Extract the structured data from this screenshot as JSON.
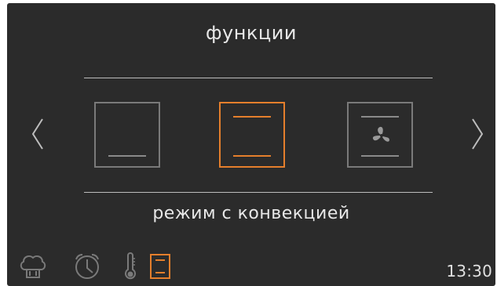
{
  "header": {
    "title": "функции"
  },
  "modes": {
    "current_label": "режим с конвекцией",
    "items": [
      {
        "name": "bottom-heat",
        "selected": false
      },
      {
        "name": "top-bottom-heat",
        "selected": true
      },
      {
        "name": "fan-heat",
        "selected": false
      }
    ]
  },
  "statusbar": {
    "icons": [
      "chef-hat-icon",
      "alarm-clock-icon",
      "thermometer-icon",
      "mode-icon"
    ],
    "time": "13:30"
  },
  "colors": {
    "background": "#2b2b2b",
    "accent": "#e57f2c",
    "inactive": "#7a7a7a",
    "text": "#e8e8e8"
  }
}
